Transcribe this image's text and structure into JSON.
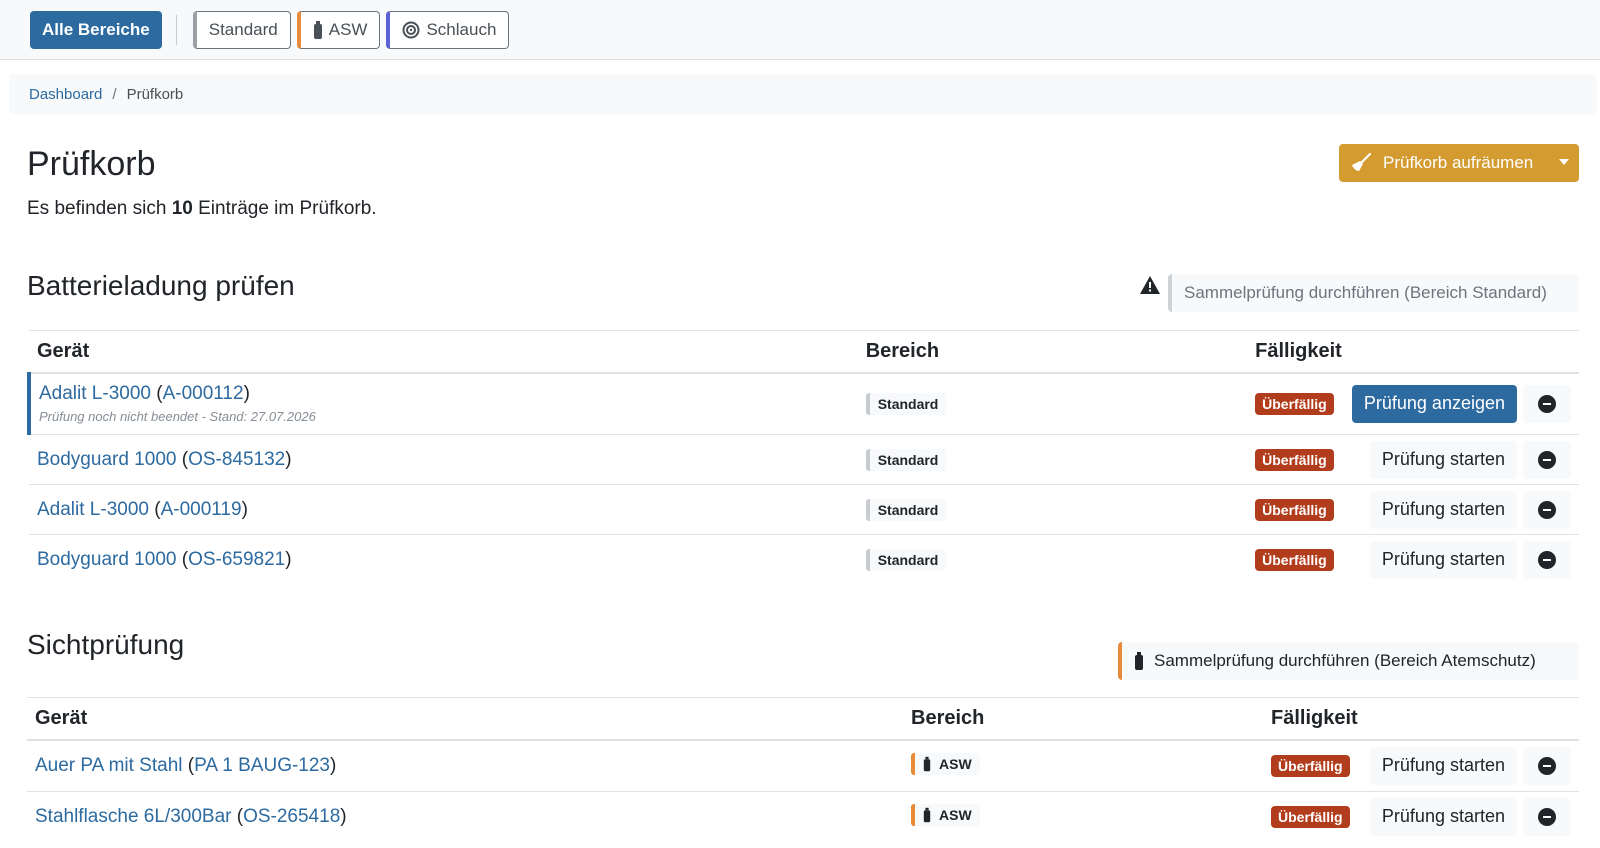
{
  "topbar": {
    "all_label": "Alle Bereiche",
    "areas": [
      {
        "label": "Standard",
        "color": "#9aa0a6"
      },
      {
        "label": "ASW",
        "color": "#e88a3a"
      },
      {
        "label": "Schlauch",
        "color": "#5a63d6"
      }
    ]
  },
  "breadcrumb": {
    "home": "Dashboard",
    "separator": "/",
    "current": "Prüfkorb"
  },
  "page": {
    "title": "Prüfkorb",
    "summary_prefix": "Es befinden sich ",
    "summary_count": "10",
    "summary_suffix": " Einträge im Prüfkorb.",
    "cleanup_label": "Prüfkorb aufräumen"
  },
  "headers": {
    "device": "Gerät",
    "area": "Bereich",
    "due": "Fälligkeit"
  },
  "sections": [
    {
      "title": "Batterieladung prüfen",
      "sammel_label": "Sammelprüfung durchführen (Bereich Standard)",
      "rows": [
        {
          "name": "Adalit L-3000",
          "id": "A-000112",
          "note": "Prüfung noch nicht beendet - Stand: 27.07.2026",
          "area": "Standard",
          "due": "Überfällig",
          "action": "Prüfung anzeigen"
        },
        {
          "name": "Bodyguard 1000",
          "id": "OS-845132",
          "area": "Standard",
          "due": "Überfällig",
          "action": "Prüfung starten"
        },
        {
          "name": "Adalit L-3000",
          "id": "A-000119",
          "area": "Standard",
          "due": "Überfällig",
          "action": "Prüfung starten"
        },
        {
          "name": "Bodyguard 1000",
          "id": "OS-659821",
          "area": "Standard",
          "due": "Überfällig",
          "action": "Prüfung starten"
        }
      ]
    },
    {
      "title": "Sichtprüfung",
      "sammel_label": "Sammelprüfung durchführen (Bereich Atemschutz)",
      "rows": [
        {
          "name": "Auer PA mit Stahl",
          "id": "PA 1 BAUG-123",
          "area": "ASW",
          "due": "Überfällig",
          "action": "Prüfung starten"
        },
        {
          "name": "Stahlflasche 6L/300Bar",
          "id": "OS-265418",
          "area": "ASW",
          "due": "Überfällig",
          "action": "Prüfung starten"
        }
      ]
    }
  ]
}
